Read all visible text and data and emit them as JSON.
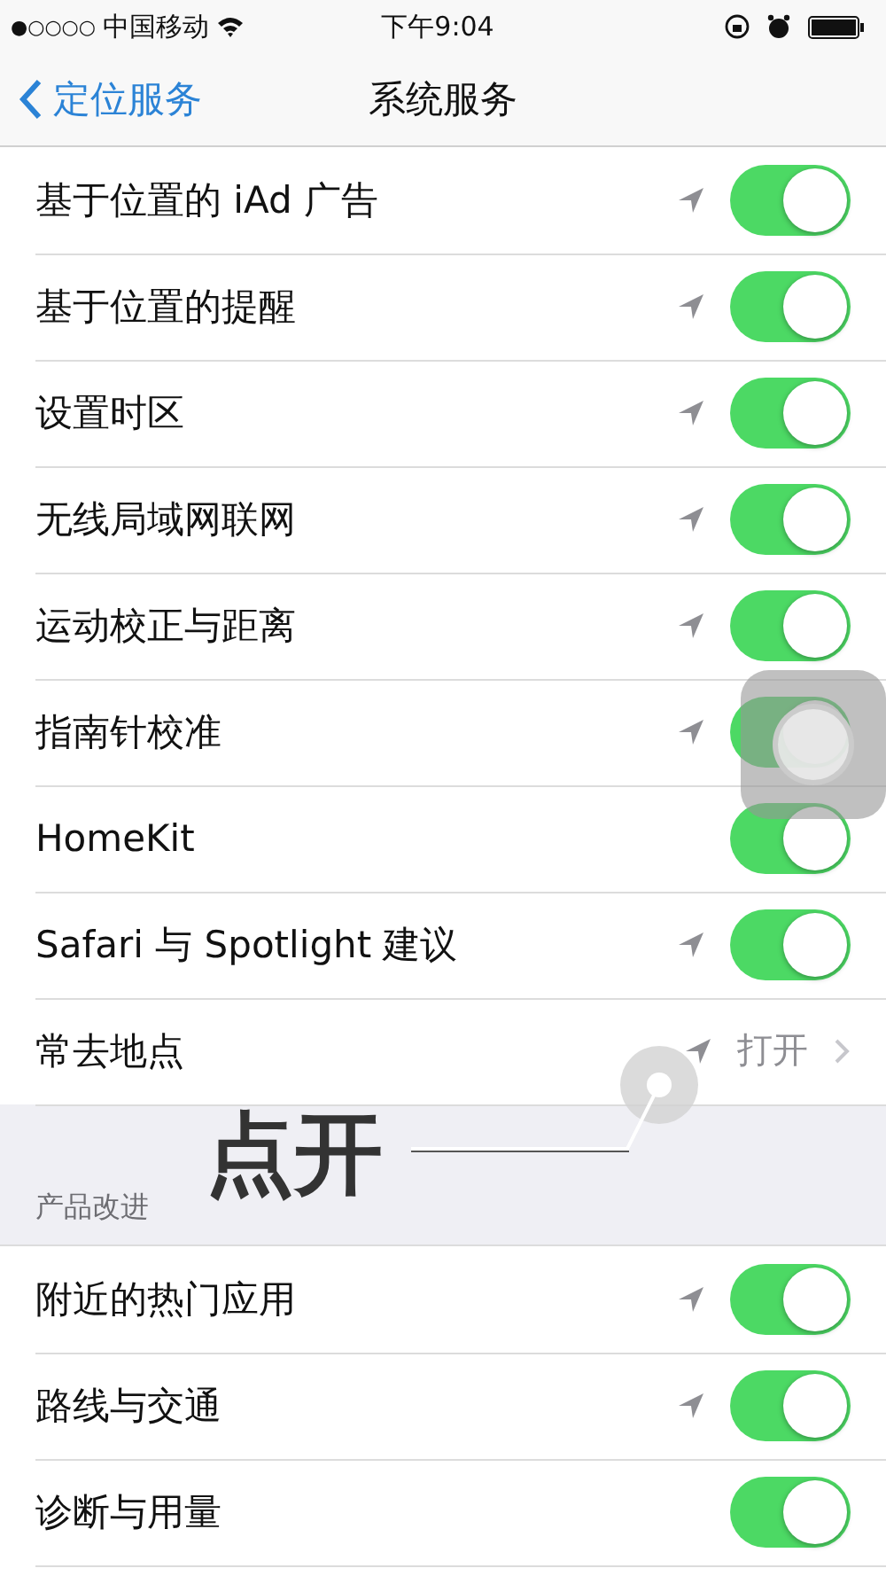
{
  "status_bar": {
    "signal_bars": "●○○○○",
    "carrier": "中国移动",
    "time": "下午9:04"
  },
  "nav": {
    "back": "定位服务",
    "title": "系统服务"
  },
  "rows": [
    {
      "label": "基于位置的 iAd 广告",
      "kind": "toggle",
      "location_arrow": true,
      "on": true
    },
    {
      "label": "基于位置的提醒",
      "kind": "toggle",
      "location_arrow": true,
      "on": true
    },
    {
      "label": "设置时区",
      "kind": "toggle",
      "location_arrow": true,
      "on": true
    },
    {
      "label": "无线局域网联网",
      "kind": "toggle",
      "location_arrow": true,
      "on": true
    },
    {
      "label": "运动校正与距离",
      "kind": "toggle",
      "location_arrow": true,
      "on": true
    },
    {
      "label": "指南针校准",
      "kind": "toggle",
      "location_arrow": true,
      "on": true
    },
    {
      "label": "HomeKit",
      "kind": "toggle",
      "location_arrow": false,
      "on": true
    },
    {
      "label": "Safari 与 Spotlight 建议",
      "kind": "toggle",
      "location_arrow": true,
      "on": true
    },
    {
      "label": "常去地点",
      "kind": "link",
      "location_arrow": true,
      "value": "打开"
    }
  ],
  "section": {
    "header": "产品改进",
    "rows": [
      {
        "label": "附近的热门应用",
        "kind": "toggle",
        "location_arrow": true,
        "on": true
      },
      {
        "label": "路线与交通",
        "kind": "toggle",
        "location_arrow": true,
        "on": true
      },
      {
        "label": "诊断与用量",
        "kind": "toggle",
        "location_arrow": false,
        "on": true
      }
    ]
  },
  "annotation": {
    "text": "点开"
  }
}
